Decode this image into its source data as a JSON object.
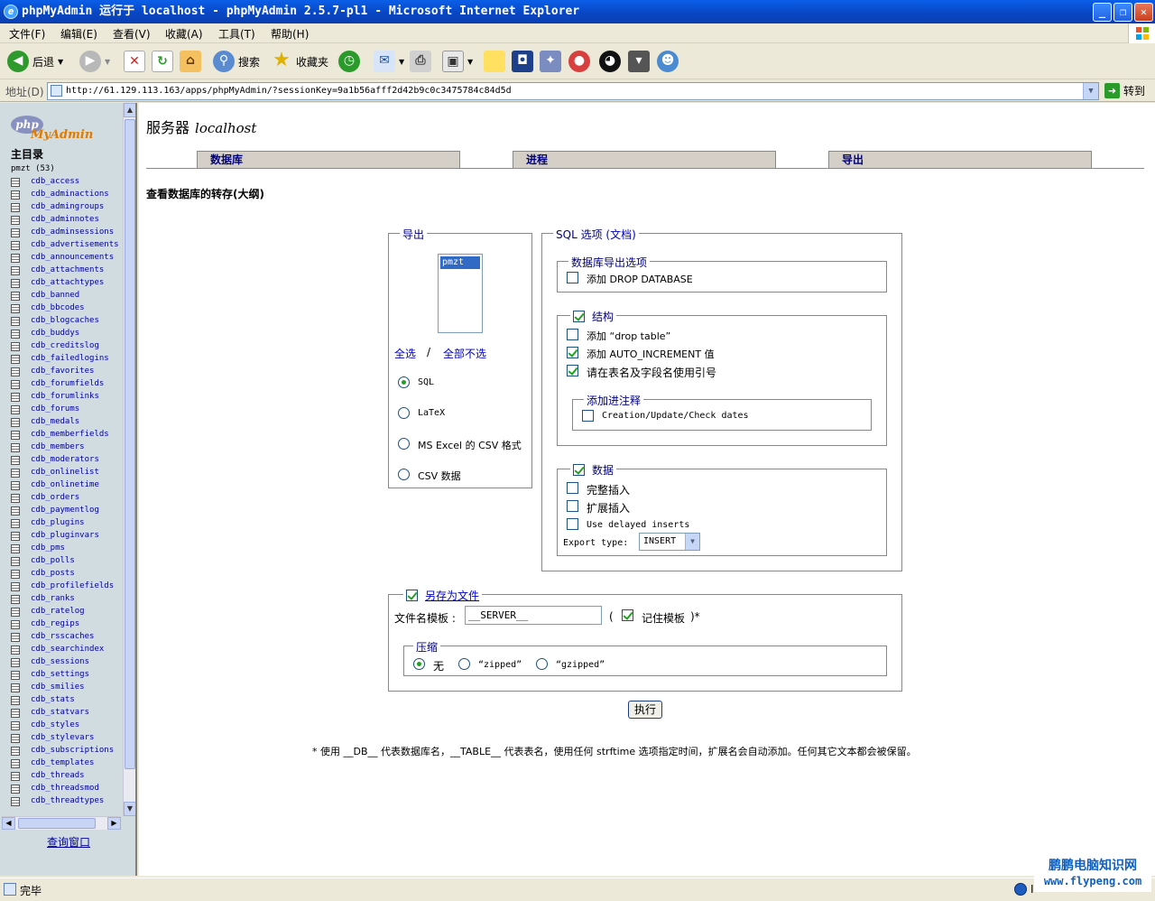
{
  "window": {
    "title": "phpMyAdmin 运行于 localhost - phpMyAdmin 2.5.7-pl1 - Microsoft Internet Explorer",
    "minimize": "_",
    "maximize": "❐",
    "close": "✕"
  },
  "menu": [
    "文件(F)",
    "编辑(E)",
    "查看(V)",
    "收藏(A)",
    "工具(T)",
    "帮助(H)"
  ],
  "toolbar": {
    "back": "后退",
    "search": "搜索",
    "favorites": "收藏夹"
  },
  "address": {
    "label": "地址(D)",
    "url": "http://61.129.113.163/apps/phpMyAdmin/?sessionKey=9a1b56afff2d42b9c0c3475784c84d5d",
    "go": "转到"
  },
  "left": {
    "home": "主目录",
    "db": "pmzt (53)",
    "tables": [
      "cdb_access",
      "cdb_adminactions",
      "cdb_admingroups",
      "cdb_adminnotes",
      "cdb_adminsessions",
      "cdb_advertisements",
      "cdb_announcements",
      "cdb_attachments",
      "cdb_attachtypes",
      "cdb_banned",
      "cdb_bbcodes",
      "cdb_blogcaches",
      "cdb_buddys",
      "cdb_creditslog",
      "cdb_failedlogins",
      "cdb_favorites",
      "cdb_forumfields",
      "cdb_forumlinks",
      "cdb_forums",
      "cdb_medals",
      "cdb_memberfields",
      "cdb_members",
      "cdb_moderators",
      "cdb_onlinelist",
      "cdb_onlinetime",
      "cdb_orders",
      "cdb_paymentlog",
      "cdb_plugins",
      "cdb_pluginvars",
      "cdb_pms",
      "cdb_polls",
      "cdb_posts",
      "cdb_profilefields",
      "cdb_ranks",
      "cdb_ratelog",
      "cdb_regips",
      "cdb_rsscaches",
      "cdb_searchindex",
      "cdb_sessions",
      "cdb_settings",
      "cdb_smilies",
      "cdb_stats",
      "cdb_statvars",
      "cdb_styles",
      "cdb_stylevars",
      "cdb_subscriptions",
      "cdb_templates",
      "cdb_threads",
      "cdb_threadsmod",
      "cdb_threadtypes"
    ],
    "query_window": "查询窗口"
  },
  "main": {
    "server_label": "服务器",
    "server_host": "localhost",
    "tabs": [
      "数据库",
      "进程",
      "导出"
    ],
    "section_title": "查看数据库的转存(大纲)",
    "export": {
      "legend": "导出",
      "db_selected": "pmzt",
      "select_all": "全选",
      "separator": "/",
      "unselect_all": "全部不选",
      "formats": [
        {
          "label": "SQL",
          "checked": true
        },
        {
          "label": "LaTeX",
          "checked": false
        },
        {
          "label": "MS Excel 的 CSV 格式",
          "checked": false
        },
        {
          "label": "CSV 数据",
          "checked": false
        }
      ]
    },
    "sql_options": {
      "legend": "SQL 选项",
      "legend_doc": "(文档)",
      "db_export_legend": "数据库导出选项",
      "add_drop_database": "添加 DROP DATABASE",
      "structure_legend": "结构",
      "add_drop_table": "添加 “drop table”",
      "add_auto_increment": "添加 AUTO_INCREMENT 值",
      "use_backquotes": "请在表名及字段名使用引号",
      "comments_legend": "添加进注释",
      "creation_dates": "Creation/Update/Check dates",
      "data_legend": "数据",
      "complete_inserts": "完整插入",
      "extended_inserts": "扩展插入",
      "delayed_inserts": "Use delayed inserts",
      "export_type_label": "Export type:",
      "export_type_value": "INSERT"
    },
    "save_file": {
      "legend": "另存为文件",
      "filename_label": "文件名模板 :",
      "filename_value": "__SERVER__",
      "paren_open": "(",
      "remember_template": "记住模板",
      "paren_close": ")*",
      "compress_legend": "压缩",
      "compress_none": "无",
      "compress_zip": "“zipped”",
      "compress_gzip": "“gzipped”"
    },
    "go_button": "执行",
    "footnote": "*  使用 __DB__ 代表数据库名，__TABLE__ 代表表名，使用任何 strftime 选项指定时间，扩展名会自动添加。任何其它文本都会被保留。"
  },
  "status": {
    "text": "完毕",
    "zone": "I"
  },
  "watermark": {
    "cn": "鹏鹏电脑知识网",
    "en": "www.flypeng.com"
  }
}
